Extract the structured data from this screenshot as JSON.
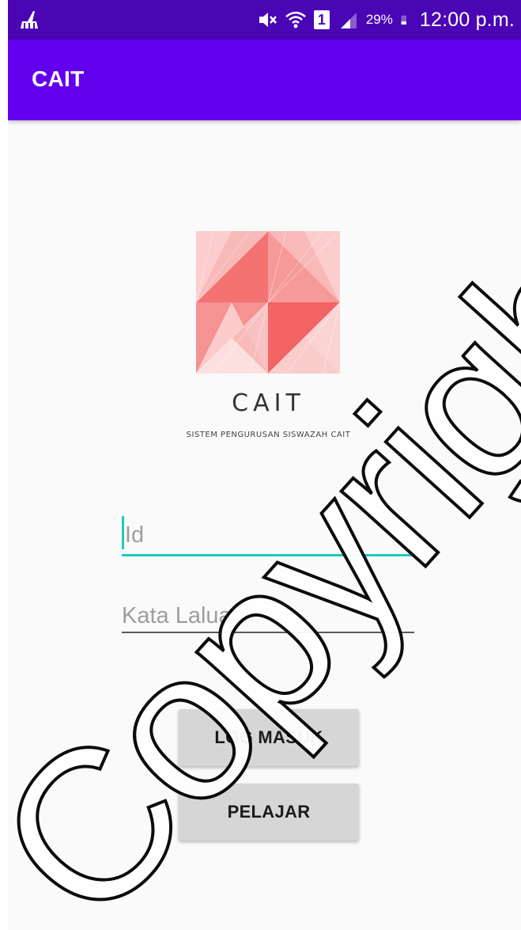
{
  "status_bar": {
    "battery_percent": "29%",
    "time": "12:00 p.m.",
    "sim_label": "1",
    "icons": [
      "cleaner-icon",
      "mute-icon",
      "wifi-icon",
      "sim-icon",
      "signal-icon",
      "battery-icon"
    ]
  },
  "app_bar": {
    "title": "CAIT"
  },
  "brand": {
    "name": "CAIT",
    "subtitle": "SISTEM PENGURUSAN SISWAZAH CAIT"
  },
  "login_form": {
    "id_placeholder": "Id",
    "id_value": "",
    "password_placeholder": "Kata Laluan",
    "password_value": "",
    "login_button": "LOG MASUK",
    "student_button": "PELAJAR"
  },
  "colors": {
    "status_bar": "#4a05b5",
    "app_bar": "#6200ee",
    "accent": "#1ec8c0",
    "logo": "#f04848",
    "button": "#d6d6d6"
  },
  "watermark": {
    "text": "Copyright@FTSM"
  }
}
